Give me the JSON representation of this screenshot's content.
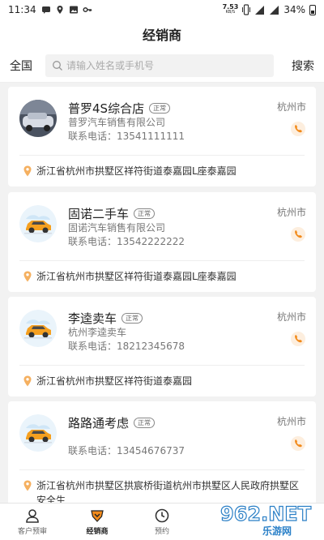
{
  "status_bar": {
    "time": "11:34",
    "net_speed_value": "7.53",
    "net_speed_unit": "KB/S",
    "battery": "34%",
    "icons": [
      "message-icon",
      "location-icon",
      "image-icon",
      "key-icon",
      "vibrate-icon",
      "signal-icon",
      "battery-icon"
    ]
  },
  "header": {
    "title": "经销商"
  },
  "search": {
    "filter_label": "全国",
    "placeholder": "请输入姓名或手机号",
    "value": "",
    "button_label": "搜索"
  },
  "dealers": [
    {
      "name": "普罗4S综合店",
      "badge": "正常",
      "company": "普罗汽车销售有限公司",
      "phone": "联系电话：13541111111",
      "city": "杭州市",
      "address": "浙江省杭州市拱墅区祥符街道泰嘉园L座泰嘉园",
      "avatar": "store-photo"
    },
    {
      "name": "固诺二手车",
      "badge": "正常",
      "company": "固诺汽车销售有限公司",
      "phone": "联系电话：13542222222",
      "city": "杭州市",
      "address": "浙江省杭州市拱墅区祥符街道泰嘉园L座泰嘉园",
      "avatar": "car-icon"
    },
    {
      "name": "李逵卖车",
      "badge": "正常",
      "company": "杭州李逵卖车",
      "phone": "联系电话：18212345678",
      "city": "杭州市",
      "address": "浙江省杭州市拱墅区祥符街道泰嘉园",
      "avatar": "car-icon"
    },
    {
      "name": "路路通考虑",
      "badge": "正常",
      "company": "",
      "phone": "联系电话：13454676737",
      "city": "杭州市",
      "address": "浙江省杭州市拱墅区拱宸桥街道杭州市拱墅区人民政府拱墅区安全生",
      "avatar": "car-icon"
    }
  ],
  "tabbar": {
    "tabs": [
      {
        "label": "客户预审",
        "icon": "person-icon",
        "active": false
      },
      {
        "label": "经销商",
        "icon": "dealer-icon",
        "active": true
      },
      {
        "label": "预约",
        "icon": "clock-icon",
        "active": false
      },
      {
        "label": "",
        "icon": "",
        "active": false
      },
      {
        "label": "",
        "icon": "",
        "active": false
      }
    ]
  },
  "watermark": {
    "text": "962.NET",
    "subtext": "乐游网"
  },
  "colors": {
    "accent": "#f28a1a",
    "car_body": "#f5a020",
    "sky": "#cfe6f7"
  }
}
